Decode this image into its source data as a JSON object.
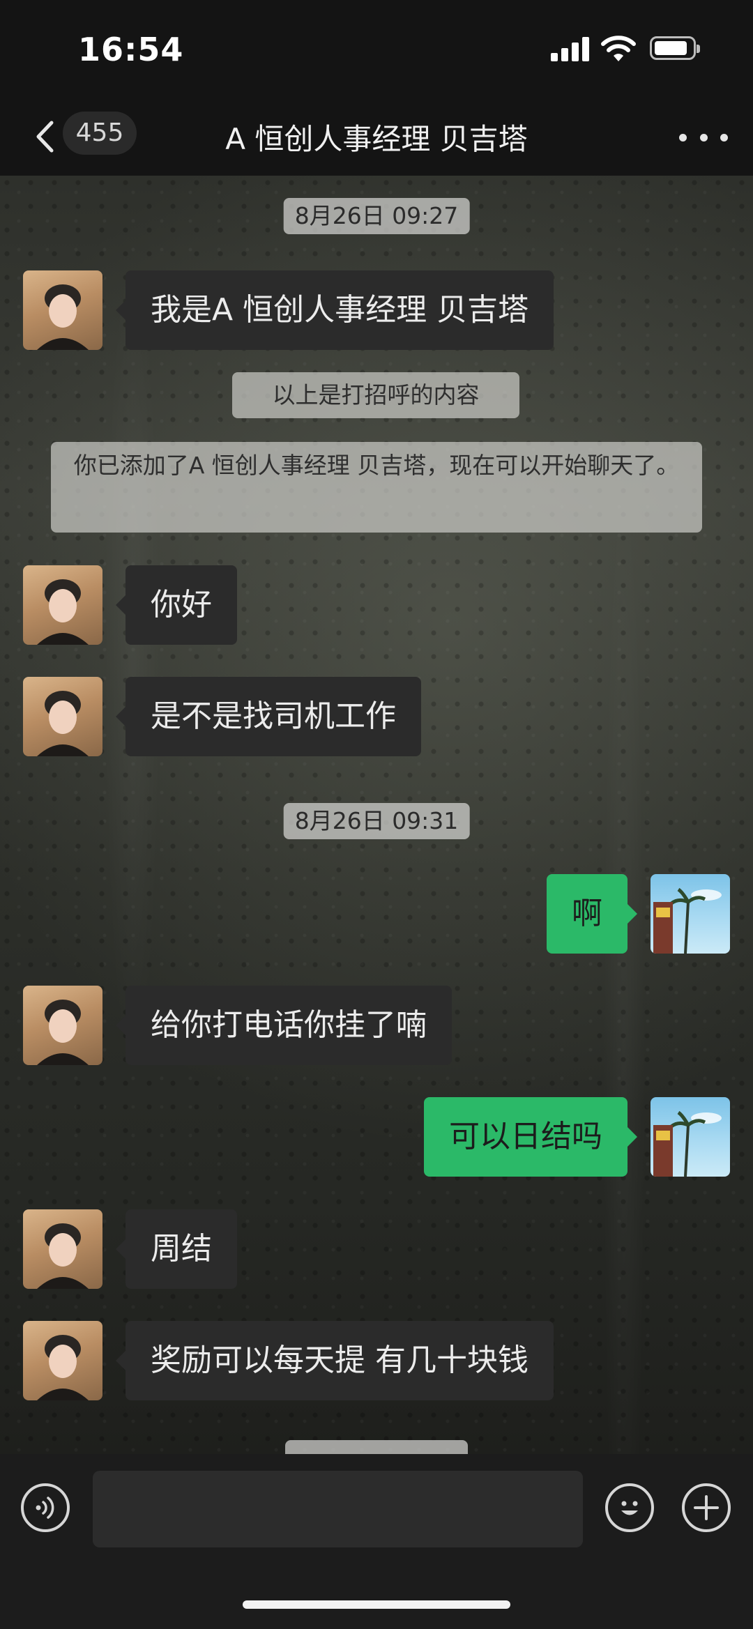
{
  "status_bar": {
    "time": "16:54"
  },
  "nav": {
    "unread_count": "455",
    "title": "A 恒创人事经理 贝吉塔"
  },
  "chat": {
    "timestamps": [
      "8月26日 09:27",
      "8月26日 09:31"
    ],
    "system_notes": [
      "以上是打招呼的内容",
      "你已添加了A 恒创人事经理 贝吉塔，现在可以开始聊天了。"
    ],
    "messages": [
      {
        "side": "in",
        "text": "我是A 恒创人事经理 贝吉塔"
      },
      {
        "side": "in",
        "text": "你好"
      },
      {
        "side": "in",
        "text": "是不是找司机工作"
      },
      {
        "side": "out",
        "text": "啊"
      },
      {
        "side": "in",
        "text": "给你打电话你挂了喃"
      },
      {
        "side": "out",
        "text": "可以日结吗"
      },
      {
        "side": "in",
        "text": "周结"
      },
      {
        "side": "in",
        "text": "奖励可以每天提 有几十块钱"
      }
    ]
  },
  "input_bar": {
    "placeholder": ""
  },
  "colors": {
    "outgoing_bubble": "#2bb968",
    "incoming_bubble": "#2b2b2b",
    "bar_background": "#141414"
  },
  "icons": [
    "back-arrow-icon",
    "more-options-icon",
    "voice-icon",
    "emoji-icon",
    "plus-icon",
    "signal-icon",
    "wifi-icon",
    "battery-icon"
  ]
}
